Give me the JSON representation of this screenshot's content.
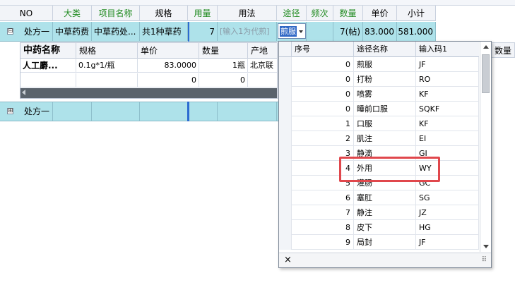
{
  "main_grid": {
    "headers": [
      {
        "label": "NO",
        "color": "#000000"
      },
      {
        "label": "大类",
        "color": "#1f8a1f"
      },
      {
        "label": "项目名称",
        "color": "#1f8a1f"
      },
      {
        "label": "规格",
        "color": "#000000"
      },
      {
        "label": "用量",
        "color": "#1f8a1f"
      },
      {
        "label": "用法",
        "color": "#000000"
      },
      {
        "label": "途径",
        "color": "#1f8a1f"
      },
      {
        "label": "频次",
        "color": "#1f8a1f"
      },
      {
        "label": "数量",
        "color": "#1f8a1f"
      },
      {
        "label": "单价",
        "color": "#000000"
      },
      {
        "label": "小计",
        "color": "#000000"
      }
    ],
    "row1": {
      "no": "处方一",
      "category": "中草药费",
      "item_name": "中草药处...",
      "spec": "共1种草药",
      "dosage": "7",
      "usage_placeholder": "[输入1为代煎]",
      "route": "煎服",
      "quantity": "7(帖)",
      "unit_price": "83.000",
      "subtotal": "581.000"
    },
    "row2": {
      "no": "处方一"
    }
  },
  "nested_grid": {
    "headers": [
      "中药名称",
      "规格",
      "单价",
      "数量",
      "产地"
    ],
    "rows": [
      {
        "name": "人工麝...",
        "spec": "0.1g*1/瓶",
        "price": "83.0000",
        "qty": "1瓶",
        "origin": "北京联"
      },
      {
        "name": "",
        "spec": "",
        "price": "0",
        "qty": "0",
        "origin": ""
      }
    ]
  },
  "right_header": {
    "label": "数量"
  },
  "dropdown": {
    "headers": [
      "序号",
      "途径名称",
      "输入码1"
    ],
    "rows": [
      {
        "seq": "0",
        "name": "煎服",
        "code": "JF"
      },
      {
        "seq": "0",
        "name": "打粉",
        "code": "RO"
      },
      {
        "seq": "0",
        "name": "喷雾",
        "code": "KF"
      },
      {
        "seq": "0",
        "name": "睡前口服",
        "code": "SQKF"
      },
      {
        "seq": "1",
        "name": "口服",
        "code": "KF"
      },
      {
        "seq": "2",
        "name": "肌注",
        "code": "EI"
      },
      {
        "seq": "3",
        "name": "静滴",
        "code": "GI"
      },
      {
        "seq": "4",
        "name": "外用",
        "code": "WY"
      },
      {
        "seq": "5",
        "name": "灌肠",
        "code": "GC"
      },
      {
        "seq": "6",
        "name": "塞肛",
        "code": "SG"
      },
      {
        "seq": "7",
        "name": "静注",
        "code": "JZ"
      },
      {
        "seq": "8",
        "name": "皮下",
        "code": "HG"
      },
      {
        "seq": "9",
        "name": "局封",
        "code": "JF"
      }
    ],
    "close_glyph": "×",
    "resize_glyph": "⠿",
    "highlight_color": "#e0474c"
  },
  "expander": {
    "collapse": "⊟",
    "expand": "⊞"
  }
}
